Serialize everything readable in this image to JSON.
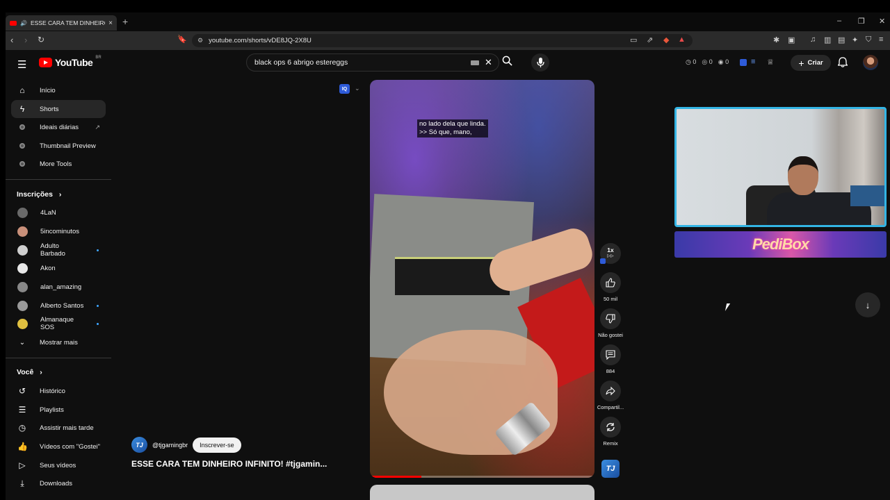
{
  "browser": {
    "tab_title": "ESSE CARA TEM DINHEIRO IN",
    "tab_close": "×",
    "new_tab": "+",
    "url": "youtube.com/shorts/vDE8JQ-2X8U",
    "win_min": "–",
    "win_max": "❐",
    "win_close": "✕"
  },
  "header": {
    "logo": "YouTube",
    "country": "BR",
    "search_value": "black ops 6 abrigo estereggs",
    "counters": [
      "0",
      "0",
      "0"
    ],
    "create_label": "Criar"
  },
  "sidebar": {
    "main": [
      {
        "label": "Início",
        "icon": "home-icon"
      },
      {
        "label": "Shorts",
        "icon": "shorts-icon",
        "active": true
      },
      {
        "label": "Ideais diárias",
        "icon": "extension-icon"
      },
      {
        "label": "Thumbnail Preview",
        "icon": "extension-icon"
      },
      {
        "label": "More Tools",
        "icon": "extension-icon"
      }
    ],
    "subs_title": "Inscrições",
    "subs": [
      {
        "label": "4LaN",
        "color": "#6a6a6a"
      },
      {
        "label": "5incominutos",
        "color": "#c9907a"
      },
      {
        "label": "Adulto Barbado",
        "color": "#cfcfcf",
        "live": true
      },
      {
        "label": "Akon",
        "color": "#e8e8e8"
      },
      {
        "label": "alan_amazing",
        "color": "#888888"
      },
      {
        "label": "Alberto Santos",
        "color": "#9a9a9a",
        "live": true
      },
      {
        "label": "Almanaque SOS",
        "color": "#e0c040",
        "live": true
      }
    ],
    "show_more": "Mostrar mais",
    "you_title": "Você",
    "you": [
      {
        "label": "Histórico",
        "icon": "history-icon"
      },
      {
        "label": "Playlists",
        "icon": "playlists-icon"
      },
      {
        "label": "Assistir mais tarde",
        "icon": "watch-later-icon"
      },
      {
        "label": "Vídeos com \"Gostei\"",
        "icon": "like-icon"
      },
      {
        "label": "Seus vídeos",
        "icon": "your-videos-icon"
      },
      {
        "label": "Downloads",
        "icon": "download-icon"
      }
    ]
  },
  "short": {
    "iq_badge": "IQ",
    "subtitle_1": "no lado dela que linda.",
    "subtitle_2": ">> Só que, mano,",
    "progress": 0.23,
    "speed": "1x",
    "likes": "50 mil",
    "dislike_label": "Não gostei",
    "comments": "884",
    "share_label": "Compartil...",
    "remix_label": "Remix",
    "channel": "@tjgamingbr",
    "channel_initials": "TJ",
    "subscribe_label": "Inscrever-se",
    "title": "ESSE CARA TEM DINHEIRO INFINITO! #tjgamin..."
  },
  "overlay": {
    "banner_text": "PediBox"
  }
}
